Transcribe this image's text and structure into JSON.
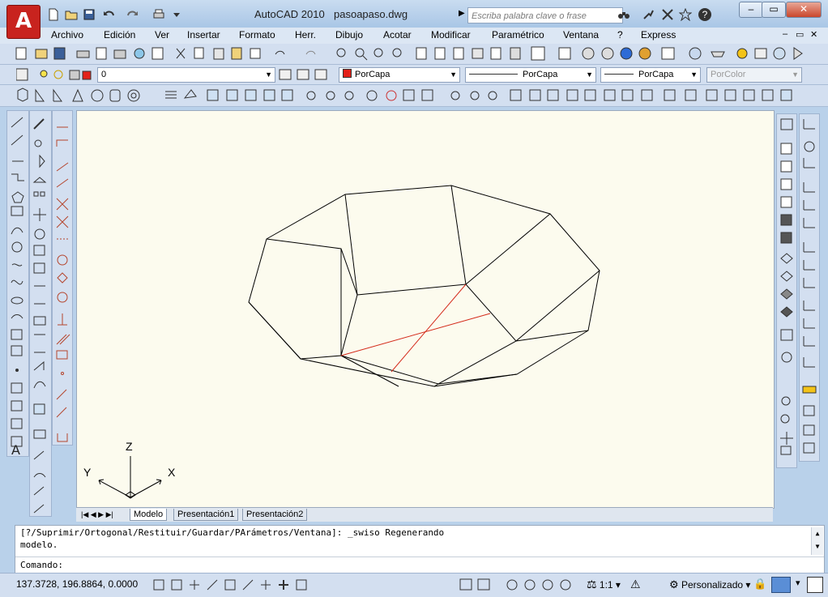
{
  "titlebar": {
    "app_logo": "A",
    "title": "AutoCAD 2010",
    "filename": "pasoapaso.dwg",
    "search_placeholder": "Escriba palabra clave o frase",
    "help_label": "?"
  },
  "menu": {
    "items": [
      "Archivo",
      "Edición",
      "Ver",
      "Insertar",
      "Formato",
      "Herr.",
      "Dibujo",
      "Acotar",
      "Modificar",
      "Paramétrico",
      "Ventana",
      "?",
      "Express"
    ]
  },
  "layers": {
    "layer_value": "0",
    "color_value": "PorCapa",
    "linetype_value": "PorCapa",
    "lineweight_value": "PorCapa",
    "plotstyle_value": "PorColor"
  },
  "ucs": {
    "z_label": "Z",
    "y_label": "Y",
    "x_label": "X"
  },
  "layout_tabs": [
    "Modelo",
    "Presentación1",
    "Presentación2"
  ],
  "command": {
    "history_line1": "[?/Suprimir/Ortogonal/Restituir/Guardar/PArámetros/Ventana]: _swiso Regenerando",
    "history_line2": "modelo.",
    "prompt": "Comando:"
  },
  "status": {
    "coordinates": "137.3728, 196.8864, 0.0000",
    "scale": "1:1",
    "workspace": "Personalizado"
  },
  "colors": {
    "accent_red": "#c8231e",
    "drawing_bg": "#fcfbee",
    "red_line": "#d42a1a"
  }
}
